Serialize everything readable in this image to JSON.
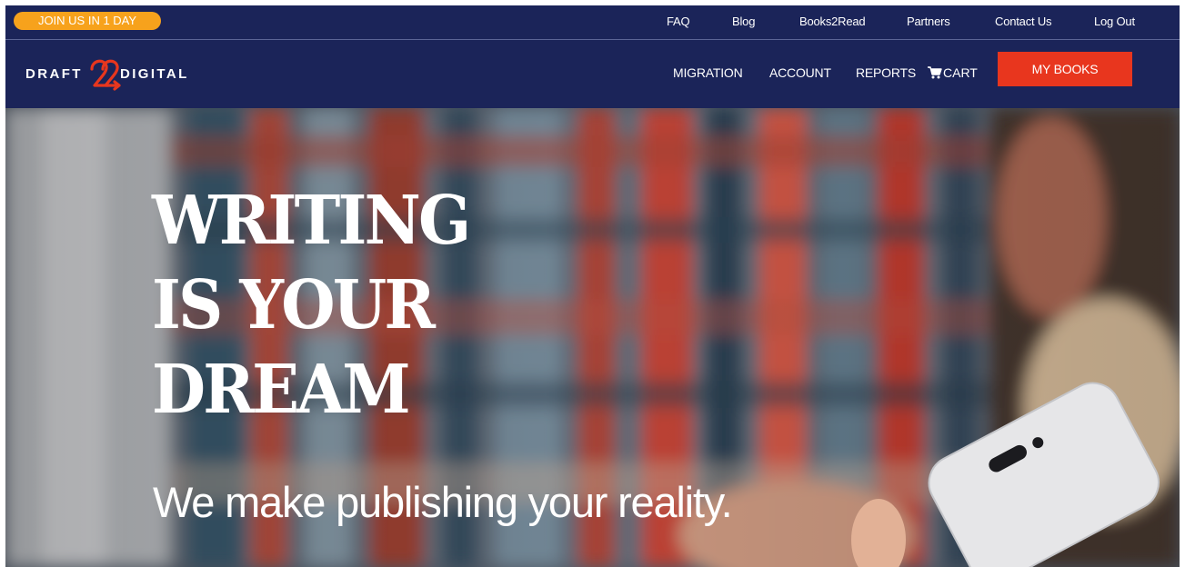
{
  "colors": {
    "nav_bg": "#1b2459",
    "join_pill": "#f7a21c",
    "my_books_button": "#e8361e",
    "text": "#ffffff"
  },
  "topbar": {
    "join_label": "JOIN US IN 1 DAY",
    "links": [
      "FAQ",
      "Blog",
      "Books2Read",
      "Partners",
      "Contact Us",
      "Log Out"
    ]
  },
  "nav": {
    "logo_left": "DRAFT",
    "logo_right": "DIGITAL",
    "links": [
      "MIGRATION",
      "ACCOUNT",
      "REPORTS"
    ],
    "cart_label": "CART",
    "cart_icon": "cart-icon",
    "my_books_label": "MY BOOKS"
  },
  "hero": {
    "headline": [
      "WRITING",
      "IS YOUR",
      "DREAM"
    ],
    "tagline": "We make publishing your reality."
  }
}
